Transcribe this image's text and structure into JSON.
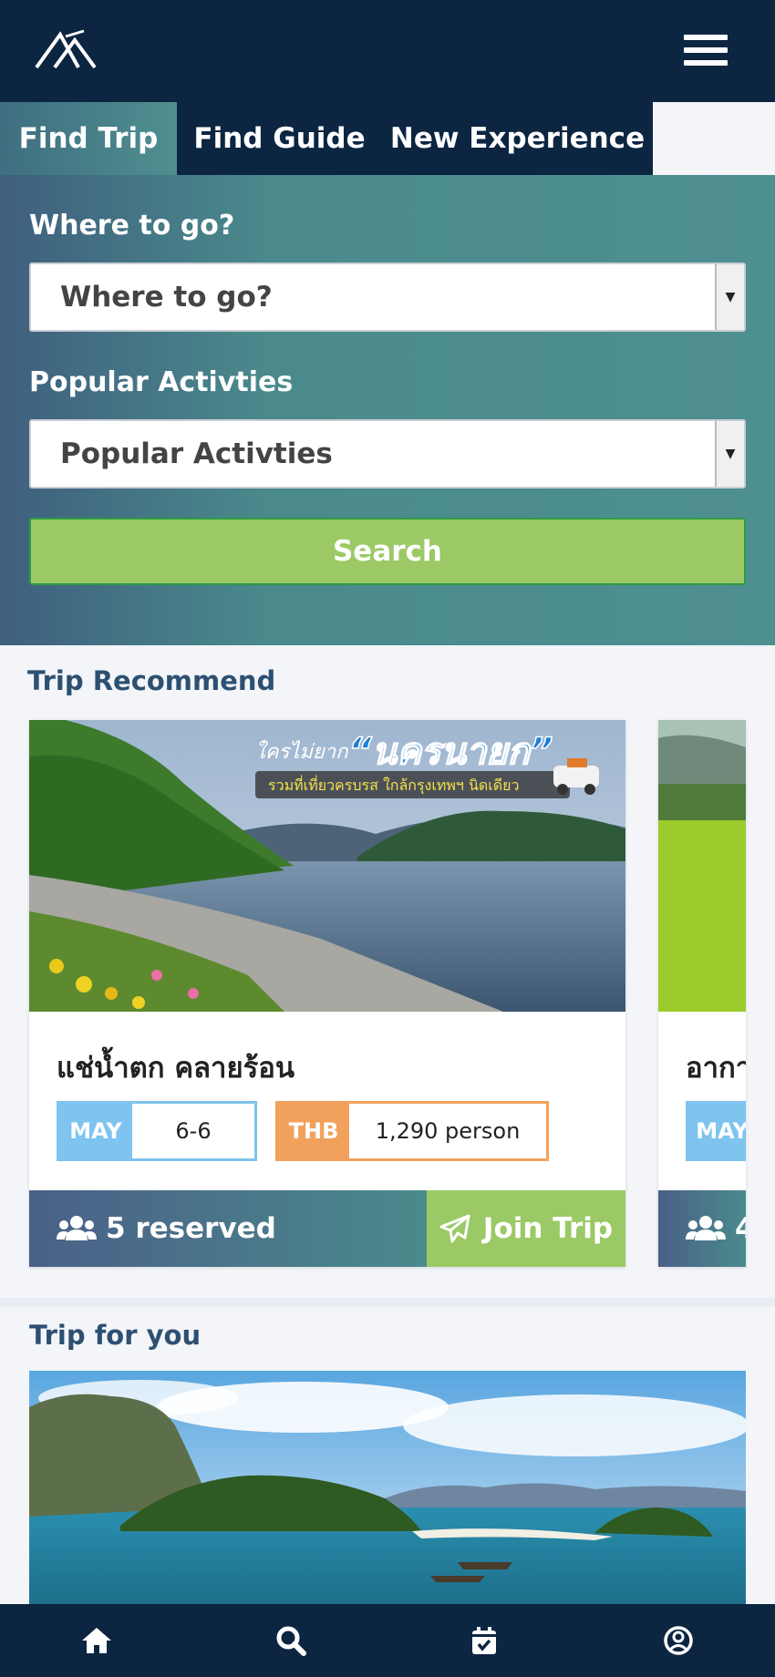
{
  "tabs": [
    "Find Trip",
    "Find Guide",
    "New Experience"
  ],
  "search": {
    "where_label": "Where to go?",
    "where_value": "Where to go?",
    "activities_label": "Popular Activties",
    "activities_value": "Popular Activties",
    "button_label": "Search"
  },
  "trip_recommend": {
    "title": "Trip Recommend",
    "cards": [
      {
        "title": "แช่น้ำตก คลายร้อน",
        "banner_small": "ใครไม่ยาก",
        "banner_big": "“นครนายก”",
        "banner_sub": "รวมที่เที่ยวครบรส ใกล้กรุงเทพฯ นิดเดียว",
        "month": "MAY",
        "dates": "6-6",
        "currency": "THB",
        "price": "1,290 person",
        "reserved": "5 reserved",
        "join": "Join Trip"
      },
      {
        "title": "อากา",
        "month": "MAY",
        "reserved": "4"
      }
    ]
  },
  "trip_for_you": {
    "title": "Trip for you"
  },
  "colors": {
    "navy": "#0c2541",
    "teal": "#4e8f90",
    "green": "#9bc966",
    "sky": "#7ec4ef",
    "orange": "#f2a15c"
  },
  "icons": [
    "logo-icon",
    "menu-icon",
    "users-icon",
    "paper-plane-icon",
    "home-icon",
    "search-icon",
    "calendar-check-icon",
    "user-circle-icon"
  ]
}
